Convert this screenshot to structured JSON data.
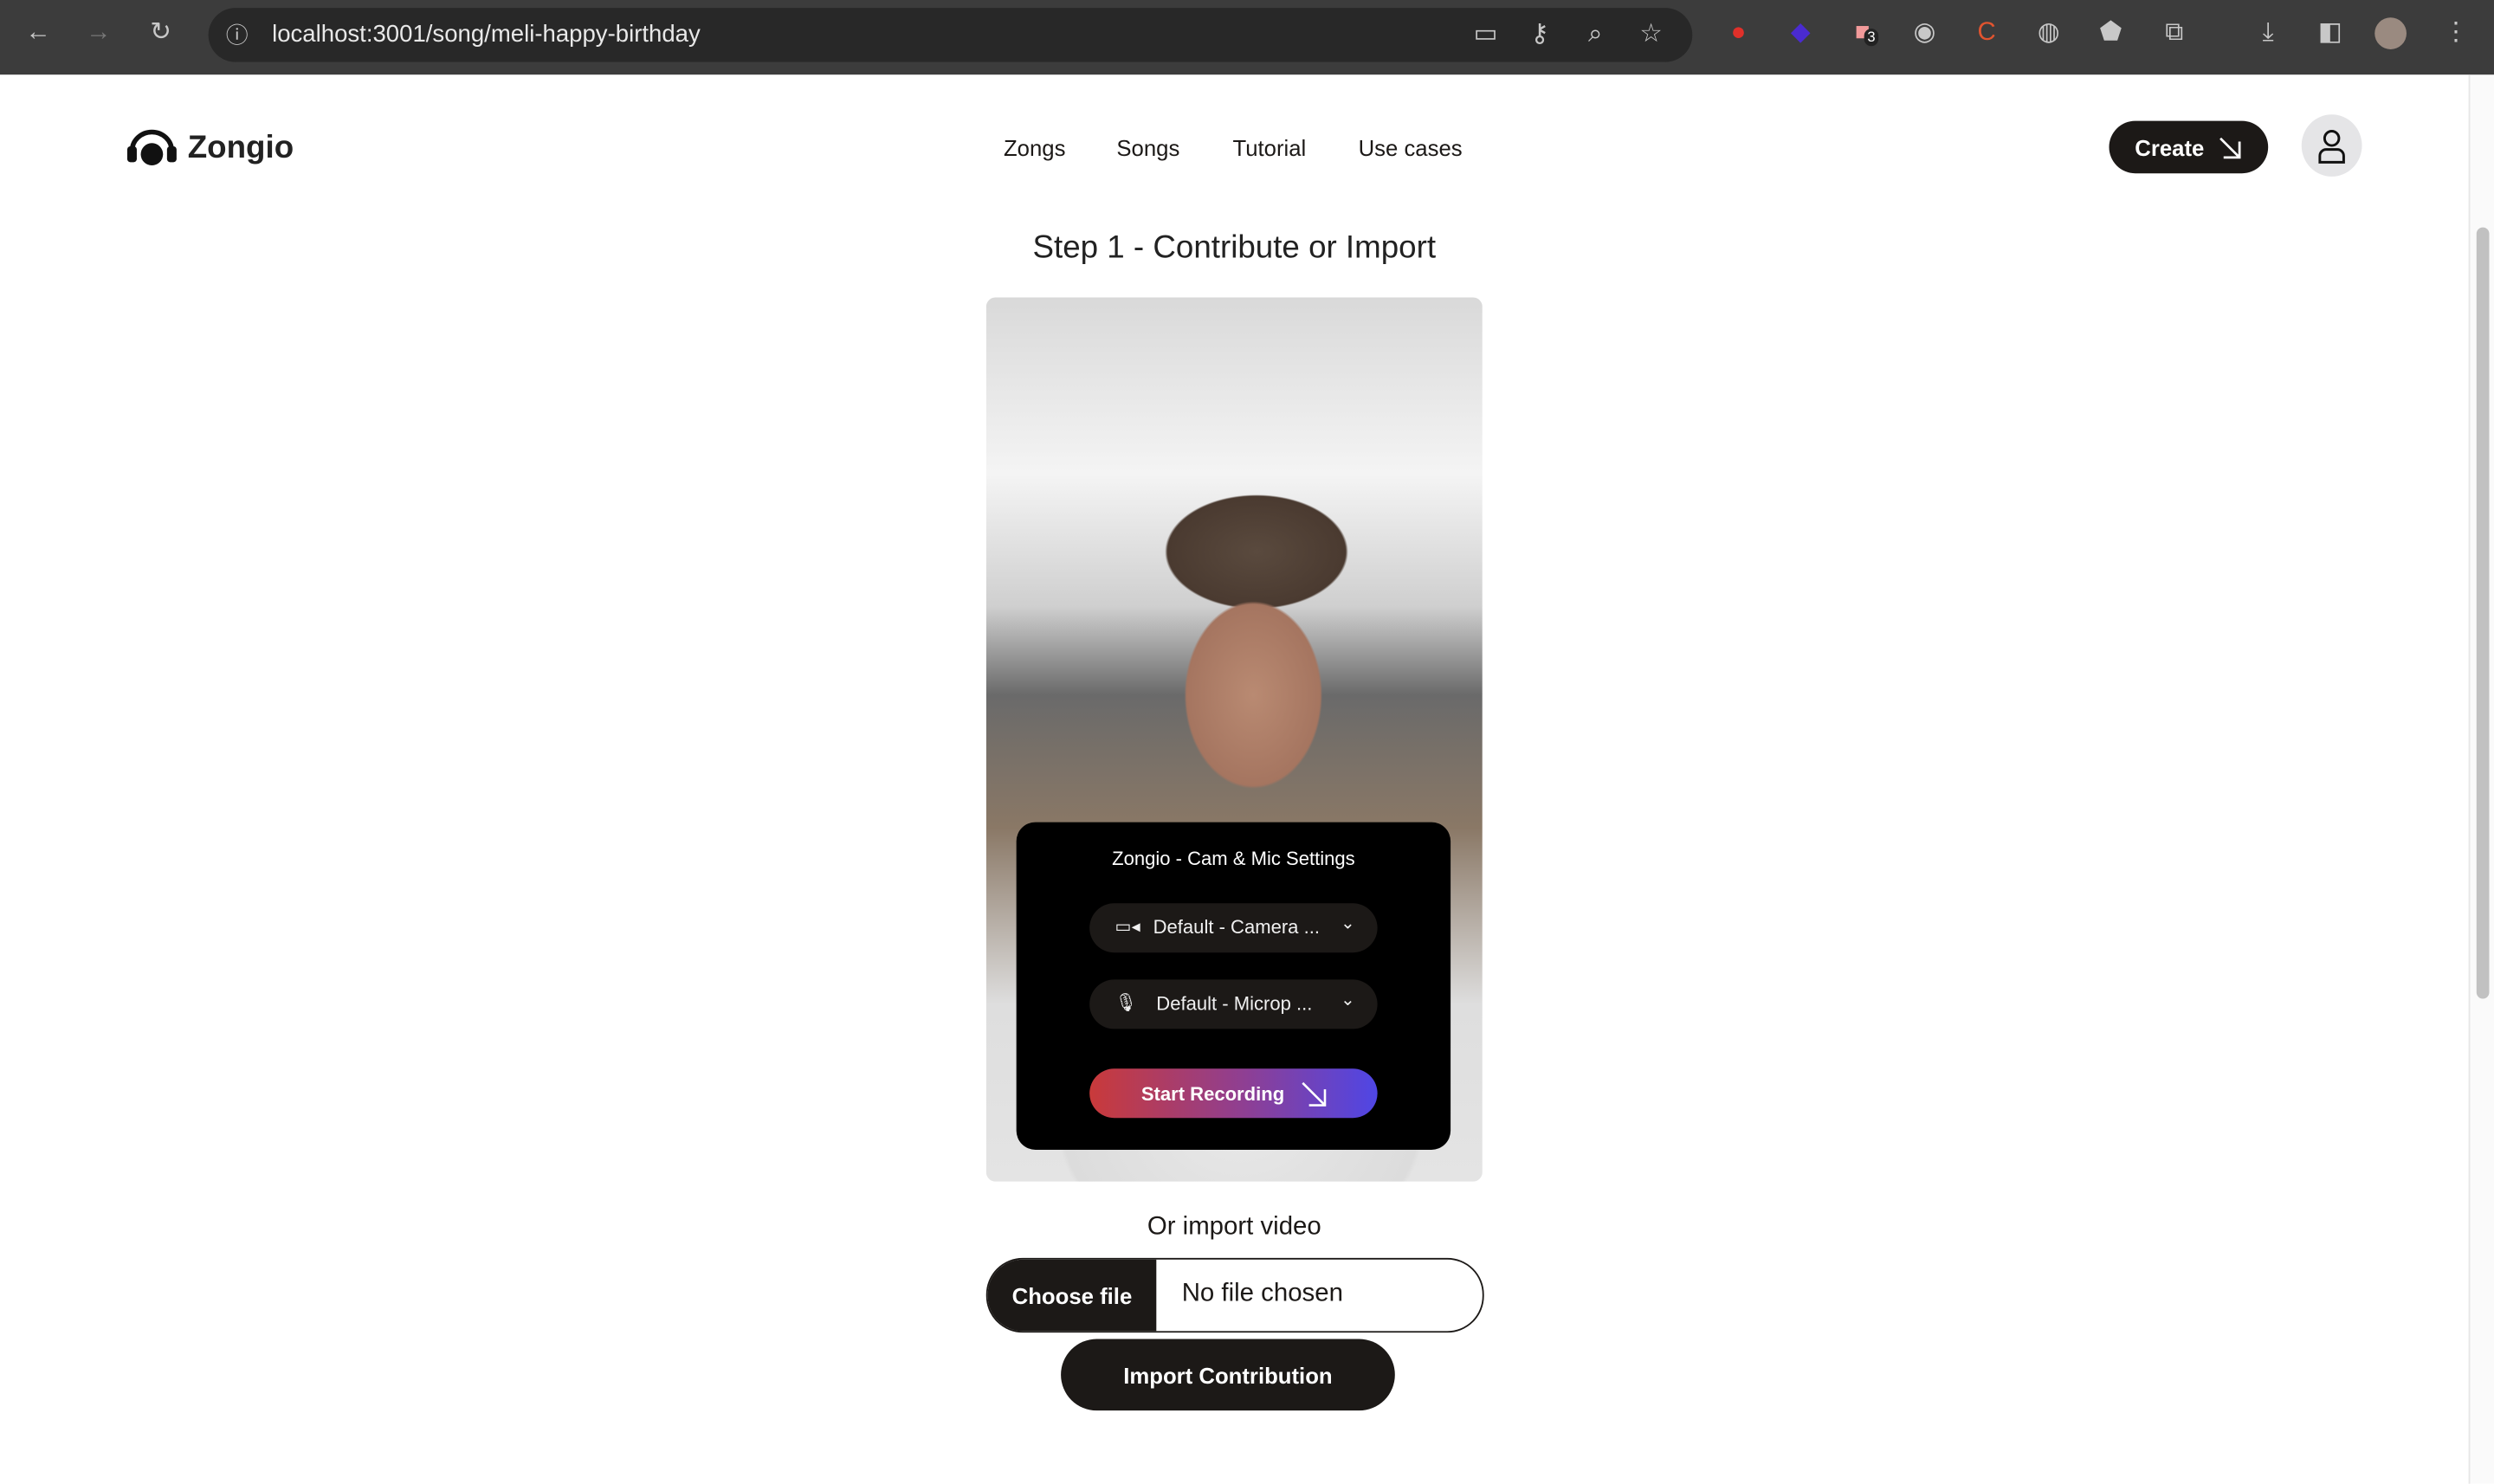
{
  "browser": {
    "url": "localhost:3001/song/meli-happy-birthday",
    "extension_badge": "3"
  },
  "header": {
    "logo_text": "Zongio",
    "nav": [
      {
        "label": "Zongs"
      },
      {
        "label": "Songs"
      },
      {
        "label": "Tutorial"
      },
      {
        "label": "Use cases"
      }
    ],
    "create_label": "Create"
  },
  "main": {
    "title": "Step 1 - Contribute or Import",
    "settings": {
      "title": "Zongio - Cam & Mic Settings",
      "camera_value": "Default - Camera ...",
      "mic_value": "Default - Microp ...",
      "start_label": "Start Recording",
      "gradient_colors": [
        "#c93a3a",
        "#4f46e5"
      ]
    },
    "import_heading": "Or import video",
    "choose_file_label": "Choose file",
    "no_file_text": "No file chosen",
    "import_button_label": "Import Contribution"
  }
}
